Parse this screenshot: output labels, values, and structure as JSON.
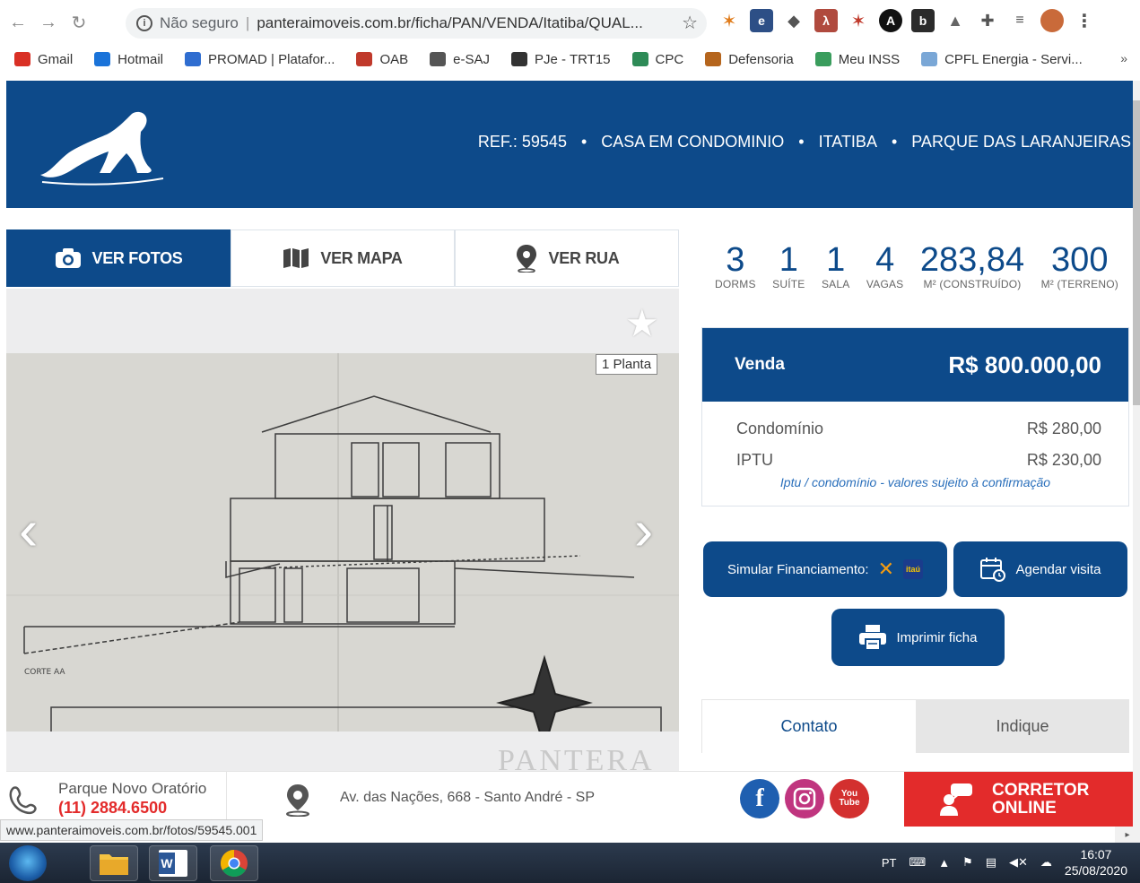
{
  "browser": {
    "security_label": "Não seguro",
    "url": "panteraimoveis.com.br/ficha/PAN/VENDA/Itatiba/QUAL...",
    "bookmarks": [
      {
        "label": "Gmail",
        "icon": "gmail-icon",
        "color": "#d93025"
      },
      {
        "label": "Hotmail",
        "icon": "outlook-icon",
        "color": "#1a73d9"
      },
      {
        "label": "PROMAD | Platafor...",
        "icon": "promad-icon",
        "color": "#2f6dd0"
      },
      {
        "label": "OAB",
        "icon": "oab-icon",
        "color": "#c0392b"
      },
      {
        "label": "e-SAJ",
        "icon": "esaj-icon",
        "color": "#555555"
      },
      {
        "label": "PJe - TRT15",
        "icon": "pje-icon",
        "color": "#333333"
      },
      {
        "label": "CPC",
        "icon": "cpc-icon",
        "color": "#2e8b57"
      },
      {
        "label": "Defensoria",
        "icon": "defensoria-icon",
        "color": "#b5651d"
      },
      {
        "label": "Meu INSS",
        "icon": "inss-icon",
        "color": "#3a9d5d"
      },
      {
        "label": "CPFL Energia - Servi...",
        "icon": "cpfl-icon",
        "color": "#7aa7d6"
      }
    ],
    "bookmarks_more": "»",
    "status_url": "www.panteraimoveis.com.br/fotos/59545.001"
  },
  "header": {
    "ref": "REF.: 59545",
    "type": "CASA EM CONDOMINIO",
    "city": "ITATIBA",
    "neighborhood": "PARQUE DAS LARANJEIRAS",
    "separator": "•"
  },
  "tabs": {
    "photos": "VER FOTOS",
    "map": "VER MAPA",
    "street": "VER RUA"
  },
  "gallery": {
    "badge": "1 Planta",
    "prev": "‹",
    "next": "›",
    "watermark": "PANTERA"
  },
  "stats": [
    {
      "num": "3",
      "label": "DORMS"
    },
    {
      "num": "1",
      "label": "SUÍTE"
    },
    {
      "num": "1",
      "label": "SALA"
    },
    {
      "num": "4",
      "label": "VAGAS"
    },
    {
      "num": "283,84",
      "label": "M² (CONSTRUÍDO)"
    },
    {
      "num": "300",
      "label": "M² (TERRENO)"
    }
  ],
  "price": {
    "label": "Venda",
    "value": "R$ 800.000,00",
    "fees": [
      {
        "label": "Condomínio",
        "value": "R$ 280,00"
      },
      {
        "label": "IPTU",
        "value": "R$ 230,00"
      }
    ],
    "note": "Iptu / condomínio - valores sujeito à confirmação"
  },
  "actions": {
    "simulate": "Simular Financiamento:",
    "schedule": "Agendar visita",
    "print": "Imprimir ficha"
  },
  "contact_tabs": {
    "contact": "Contato",
    "indicate": "Indique"
  },
  "footer": {
    "office": "Parque Novo Oratório",
    "phone": "(11) 2884.6500",
    "address": "Av. das Nações, 668 - Santo André - SP",
    "broker": "CORRETOR ONLINE"
  },
  "taskbar": {
    "lang": "PT",
    "time": "16:07",
    "date": "25/08/2020"
  },
  "colors": {
    "brand": "#0d4a8a",
    "accent_red": "#e32b2b",
    "note_blue": "#2a6fbb"
  }
}
